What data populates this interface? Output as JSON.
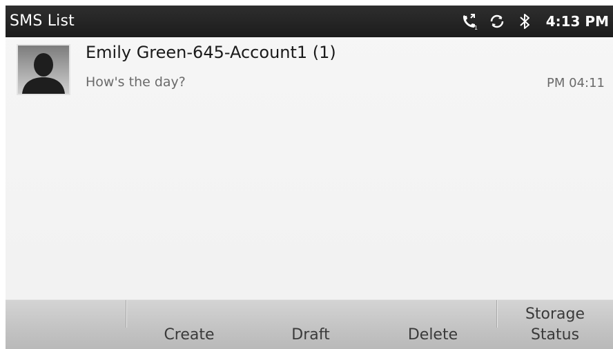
{
  "status_bar": {
    "title": "SMS List",
    "time": "4:13 PM",
    "icons": [
      "call-forward-icon",
      "sync-icon",
      "bluetooth-icon"
    ]
  },
  "messages": [
    {
      "contact": "Emily Green-645-Account1 (1)",
      "preview": "How's the day?",
      "time": "PM 04:11",
      "avatar": "person-silhouette-icon"
    }
  ],
  "toolbar": {
    "create_label": "Create",
    "draft_label": "Draft",
    "delete_label": "Delete",
    "storage_label_line1": "Storage",
    "storage_label_line2": "Status"
  },
  "colors": {
    "status_bar_bg": "#1c1c1c",
    "list_bg": "#f3f3f3",
    "toolbar_bg": "#c4c4c4",
    "primary_text": "#1a1a1a",
    "secondary_text": "#6a6a6a"
  }
}
